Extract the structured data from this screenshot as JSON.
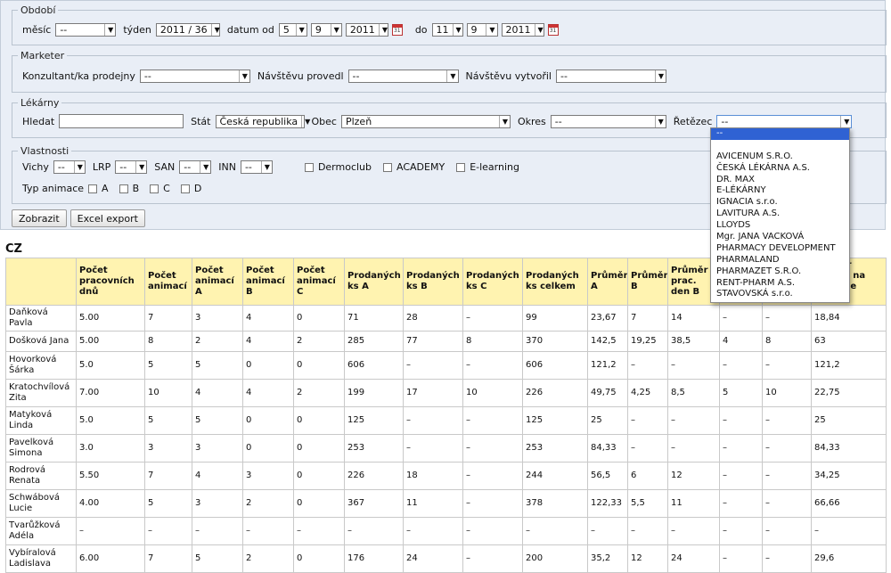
{
  "period": {
    "legend": "Období",
    "month_label": "měsíc",
    "month_value": "--",
    "week_label": "týden",
    "week_value": "2011 / 36",
    "date_from_label": "datum od",
    "from_day": "5",
    "from_month": "9",
    "from_year": "2011",
    "date_to_label": "do",
    "to_day": "11",
    "to_month": "9",
    "to_year": "2011",
    "calendar_icon_text": "31"
  },
  "marketer": {
    "legend": "Marketer",
    "consultant_label": "Konzultant/ka prodejny",
    "consultant_value": "--",
    "visit_done_label": "Návštěvu provedl",
    "visit_done_value": "--",
    "visit_created_label": "Návštěvu vytvořil",
    "visit_created_value": "--"
  },
  "pharmacies": {
    "legend": "Lékárny",
    "search_label": "Hledat",
    "search_value": "",
    "state_label": "Stát",
    "state_value": "Česká republika",
    "city_label": "Obec",
    "city_value": "Plzeň",
    "district_label": "Okres",
    "district_value": "--",
    "chain_label": "Řetězec",
    "chain_value": "--"
  },
  "properties": {
    "legend": "Vlastnosti",
    "selects": [
      {
        "label": "Vichy",
        "value": "--"
      },
      {
        "label": "LRP",
        "value": "--"
      },
      {
        "label": "SAN",
        "value": "--"
      },
      {
        "label": "INN",
        "value": "--"
      }
    ],
    "checkboxes": [
      "Dermoclub",
      "ACADEMY",
      "E-learning"
    ],
    "animation_label": "Typ animace",
    "animation_options": [
      "A",
      "B",
      "C",
      "D"
    ]
  },
  "actions": {
    "show": "Zobrazit",
    "export": "Excel export"
  },
  "section_title": "CZ",
  "table": {
    "headers": [
      "",
      "Počet pracovních dnů",
      "Počet animací",
      "Počet animací A",
      "Počet animací B",
      "Počet animací C",
      "Prodaných ks A",
      "Prodaných ks B",
      "Prodaných ks C",
      "Prodaných ks celkem",
      "Průměr A",
      "Průměr B",
      "Průměr prac. den B",
      "",
      "",
      "Průměr celkem na animace total"
    ],
    "rows": [
      [
        "Daňková Pavla",
        "5.00",
        "7",
        "3",
        "4",
        "0",
        "71",
        "28",
        "–",
        "99",
        "23,67",
        "7",
        "14",
        "–",
        "–",
        "18,84"
      ],
      [
        "Došková Jana",
        "5.00",
        "8",
        "2",
        "4",
        "2",
        "285",
        "77",
        "8",
        "370",
        "142,5",
        "19,25",
        "38,5",
        "4",
        "8",
        "63"
      ],
      [
        "Hovorková Šárka",
        "5.0",
        "5",
        "5",
        "0",
        "0",
        "606",
        "–",
        "–",
        "606",
        "121,2",
        "–",
        "–",
        "–",
        "–",
        "121,2"
      ],
      [
        "Kratochvílová Zita",
        "7.00",
        "10",
        "4",
        "4",
        "2",
        "199",
        "17",
        "10",
        "226",
        "49,75",
        "4,25",
        "8,5",
        "5",
        "10",
        "22,75"
      ],
      [
        "Matyková Linda",
        "5.0",
        "5",
        "5",
        "0",
        "0",
        "125",
        "–",
        "–",
        "125",
        "25",
        "–",
        "–",
        "–",
        "–",
        "25"
      ],
      [
        "Pavelková Simona",
        "3.0",
        "3",
        "3",
        "0",
        "0",
        "253",
        "–",
        "–",
        "253",
        "84,33",
        "–",
        "–",
        "–",
        "–",
        "84,33"
      ],
      [
        "Rodrová Renata",
        "5.50",
        "7",
        "4",
        "3",
        "0",
        "226",
        "18",
        "–",
        "244",
        "56,5",
        "6",
        "12",
        "–",
        "–",
        "34,25"
      ],
      [
        "Schwábová Lucie",
        "4.00",
        "5",
        "3",
        "2",
        "0",
        "367",
        "11",
        "–",
        "378",
        "122,33",
        "5,5",
        "11",
        "–",
        "–",
        "66,66"
      ],
      [
        "Tvarůžková Adéla",
        "–",
        "–",
        "–",
        "–",
        "–",
        "–",
        "–",
        "–",
        "–",
        "–",
        "–",
        "–",
        "–",
        "–",
        "–"
      ],
      [
        "Vybíralová Ladislava",
        "6.00",
        "7",
        "5",
        "2",
        "0",
        "176",
        "24",
        "–",
        "200",
        "35,2",
        "12",
        "24",
        "–",
        "–",
        "29,6"
      ]
    ]
  },
  "chain_dropdown": {
    "items": [
      "--",
      "",
      "AVICENUM S.R.O.",
      "ČESKÁ LÉKÁRNA A.S.",
      "DR. MAX",
      "E-LÉKÁRNY",
      "IGNACIA s.r.o.",
      "LAVITURA A.S.",
      "LLOYDS",
      "Mgr. JANA VACKOVÁ",
      "PHARMACY DEVELOPMENT",
      "PHARMALAND",
      "PHARMAZET S.R.O.",
      "RENT-PHARM A.S.",
      "STAVOVSKÁ s.r.o."
    ]
  }
}
